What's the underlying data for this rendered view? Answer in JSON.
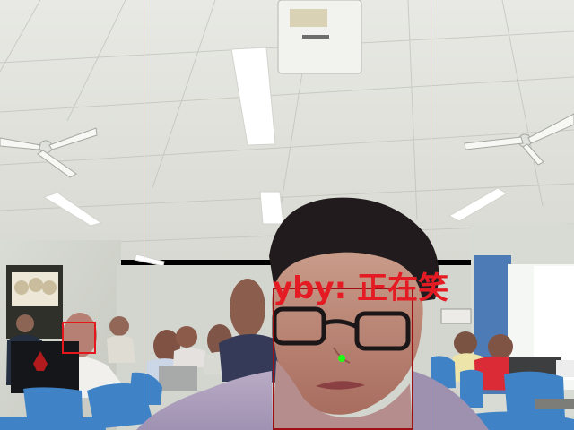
{
  "overlay": {
    "recognition_label": "yby: 正在笑",
    "primary_face": {
      "box_color": "#9f1016"
    },
    "secondary_face": {
      "box_color": "#e5161c"
    },
    "keypoint": {
      "color": "#20ff12"
    },
    "guide_lines": {
      "color": "#f2ef57"
    }
  },
  "scene": {
    "ceiling_color": "#e7e8e3",
    "wall_color": "#dedfd9",
    "chair_color": "#3f83c6",
    "icon_names": [
      "ceiling-fan-icon",
      "projector-icon",
      "person-icon"
    ]
  }
}
